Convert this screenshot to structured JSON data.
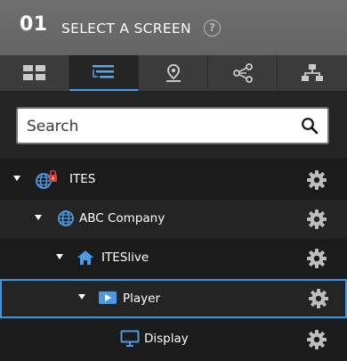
{
  "header": {
    "step": "01",
    "title": "SELECT A SCREEN",
    "help_glyph": "?"
  },
  "tabs": [
    {
      "name": "grid-view",
      "icon": "grid-icon",
      "active": false
    },
    {
      "name": "tree-view",
      "icon": "tree-list-icon",
      "active": true
    },
    {
      "name": "location-view",
      "icon": "map-pin-icon",
      "active": false
    },
    {
      "name": "share-view",
      "icon": "share-icon",
      "active": false
    },
    {
      "name": "hierarchy-view",
      "icon": "org-chart-icon",
      "active": false
    }
  ],
  "search": {
    "placeholder": "Search",
    "value": ""
  },
  "tree": [
    {
      "label": "ITES",
      "icon": "globe-lock-icon",
      "level": 0,
      "expanded": true
    },
    {
      "label": "ABC Company",
      "icon": "globe-icon",
      "level": 1,
      "expanded": true
    },
    {
      "label": "ITESlive",
      "icon": "home-icon",
      "level": 2,
      "expanded": true
    },
    {
      "label": "Player",
      "icon": "player-icon",
      "level": 3,
      "expanded": true,
      "selected": true
    },
    {
      "label": "Display",
      "icon": "monitor-icon",
      "level": 4
    }
  ],
  "colors": {
    "accent": "#3f95e0",
    "header_bg": "#6a6a6a",
    "tab_bar": "#3b3b3b",
    "row_dark": "#1b1b1b",
    "row_mid": "#242424"
  }
}
